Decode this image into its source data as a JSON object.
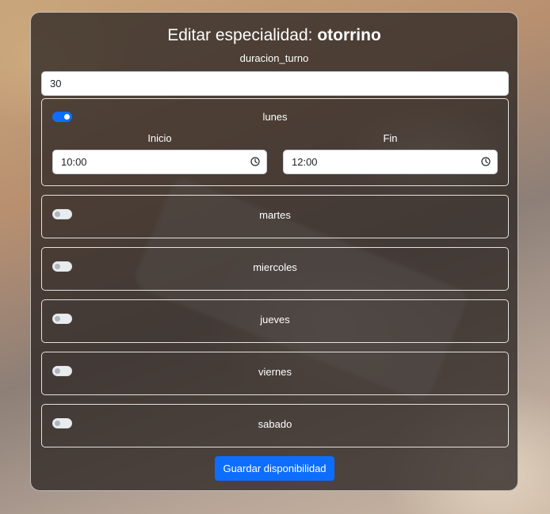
{
  "form": {
    "title_prefix": "Editar especialidad: ",
    "title_name": "otorrino",
    "duration_label": "duracion_turno",
    "duration_value": "30",
    "submit_label": "Guardar disponibilidad"
  },
  "days": [
    {
      "name": "lunes",
      "enabled": true,
      "start_label": "Inicio",
      "start_value": "10:00",
      "end_label": "Fin",
      "end_value": "12:00"
    },
    {
      "name": "martes",
      "enabled": false
    },
    {
      "name": "miercoles",
      "enabled": false
    },
    {
      "name": "jueves",
      "enabled": false
    },
    {
      "name": "viernes",
      "enabled": false
    },
    {
      "name": "sabado",
      "enabled": false
    }
  ],
  "colors": {
    "accent": "#0d6efd",
    "card_background": "#2d2624"
  },
  "icons": {
    "time_field": "clock-icon"
  }
}
